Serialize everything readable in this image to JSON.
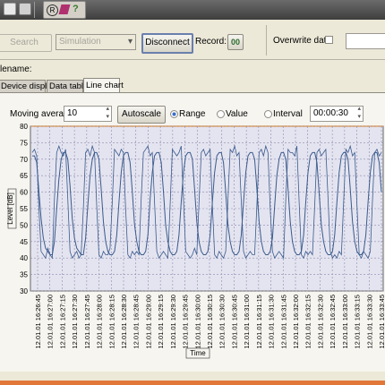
{
  "toolbar": {
    "icons": [
      "window-icon",
      "print-icon",
      "registered-icon",
      "edit-icon",
      "help-icon"
    ]
  },
  "controls": {
    "search_label": "Search",
    "source_value": "Simulation",
    "disconnect_label": "Disconnect",
    "record_label": "Record:",
    "record_button": "00",
    "overwrite_label": "Overwrite date:"
  },
  "filename_label": "lename:",
  "tabs": [
    "Device display",
    "Data table",
    "Line chart"
  ],
  "chart_controls": {
    "moving_average_label": "Moving average",
    "moving_average_value": "10",
    "autoscale_label": "Autoscale",
    "range_label": "Range",
    "value_label": "Value",
    "interval_label": "Interval",
    "interval_value": "00:00:30"
  },
  "chart_data": {
    "type": "line",
    "xlabel": "Time",
    "ylabel": "Level [dB]",
    "ylim": [
      30,
      80
    ],
    "yticks": [
      30,
      35,
      40,
      45,
      50,
      55,
      60,
      65,
      70,
      75,
      80
    ],
    "x": [
      "12.01.01 16:26:45",
      "12.01.01 16:27:00",
      "12.01.01 16:27:15",
      "12.01.01 16:27:30",
      "12.01.01 16:27:45",
      "12.01.01 16:28:00",
      "12.01.01 16:28:15",
      "12.01.01 16:28:30",
      "12.01.01 16:28:45",
      "12.01.01 16:29:00",
      "12.01.01 16:29:15",
      "12.01.01 16:29:30",
      "12.01.01 16:29:45",
      "12.01.01 16:30:00",
      "12.01.01 16:30:15",
      "12.01.01 16:30:30",
      "12.01.01 16:30:45",
      "12.01.01 16:31:00",
      "12.01.01 16:31:15",
      "12.01.01 16:31:30",
      "12.01.01 16:31:45",
      "12.01.01 16:32:00",
      "12.01.01 16:32:15",
      "12.01.01 16:32:30",
      "12.01.01 16:32:45",
      "12.01.01 16:33:00",
      "12.01.01 16:33:15",
      "12.01.01 16:33:30",
      "12.01.01 16:33:45"
    ],
    "series": [
      {
        "values": [
          72,
          73,
          71,
          55,
          42,
          41,
          40,
          43,
          41,
          40,
          58,
          72,
          74,
          72,
          71,
          73,
          58,
          42,
          40,
          41,
          42,
          40,
          41,
          55,
          72,
          73,
          71,
          74,
          72,
          56,
          41,
          40,
          42,
          41,
          41,
          43,
          57,
          73,
          72,
          71,
          73,
          72,
          55,
          41,
          40,
          42,
          41,
          42,
          41,
          58,
          72,
          73,
          74,
          71,
          72,
          57,
          42,
          40,
          41,
          42,
          41,
          40,
          56,
          73,
          72,
          71,
          72,
          74,
          58,
          42,
          41,
          40,
          41,
          43,
          41,
          57,
          72,
          73,
          71,
          72,
          73,
          56,
          41,
          40,
          42,
          41,
          40,
          42,
          58,
          73,
          72,
          74,
          71,
          72,
          57,
          42,
          40,
          41,
          42,
          41,
          41,
          56,
          72,
          73,
          71,
          74,
          72,
          55,
          42,
          40,
          41,
          42,
          41,
          40,
          58,
          73,
          72,
          72,
          71,
          74,
          57,
          41,
          40,
          42,
          41,
          42,
          41,
          56,
          72,
          73,
          71,
          72,
          73,
          58,
          42,
          40,
          41,
          40,
          42,
          41,
          57,
          73,
          72,
          74,
          71,
          72,
          56,
          41,
          40,
          42,
          41,
          40,
          42,
          58,
          72,
          73,
          71,
          72
        ]
      },
      {
        "values": [
          71,
          71,
          69,
          60,
          52,
          46,
          43,
          42,
          41,
          41,
          45,
          55,
          64,
          70,
          72,
          72,
          70,
          62,
          52,
          46,
          43,
          42,
          41,
          41,
          46,
          56,
          65,
          70,
          72,
          72,
          70,
          61,
          51,
          45,
          42,
          41,
          41,
          42,
          47,
          57,
          66,
          71,
          72,
          72,
          69,
          60,
          50,
          45,
          42,
          41,
          41,
          42,
          47,
          58,
          66,
          71,
          72,
          72,
          69,
          60,
          50,
          45,
          42,
          41,
          41,
          42,
          47,
          57,
          66,
          71,
          72,
          72,
          70,
          61,
          51,
          45,
          42,
          41,
          41,
          42,
          47,
          57,
          66,
          71,
          72,
          72,
          69,
          60,
          50,
          45,
          42,
          41,
          41,
          42,
          47,
          57,
          66,
          71,
          72,
          72,
          70,
          61,
          51,
          45,
          42,
          41,
          41,
          42,
          46,
          56,
          65,
          70,
          72,
          72,
          70,
          61,
          51,
          45,
          42,
          41,
          41,
          42,
          47,
          57,
          66,
          71,
          72,
          72,
          69,
          60,
          50,
          45,
          42,
          41,
          41,
          42,
          47,
          57,
          66,
          71,
          72,
          72,
          70,
          61,
          51,
          45,
          42,
          41,
          41,
          42,
          47,
          57,
          66,
          71,
          72,
          72,
          69,
          60
        ]
      }
    ],
    "colors": {
      "line": "#3a5a8c",
      "grid": "#8a8ab0",
      "plot_bg": "#e4e4f0",
      "top_line": "#e0a060"
    }
  }
}
